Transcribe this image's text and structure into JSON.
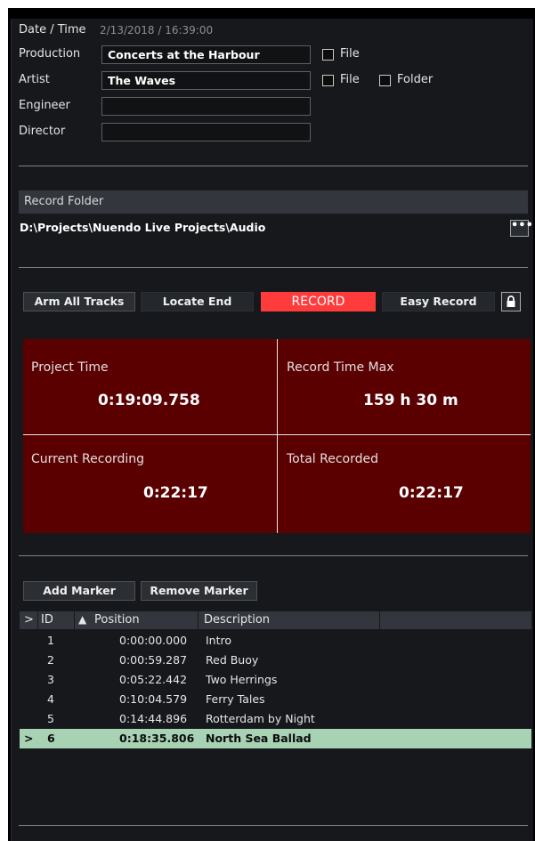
{
  "info": {
    "datetime_label": "Date / Time",
    "datetime_value": "2/13/2018  /  16:39:00",
    "production_label": "Production",
    "production_value": "Concerts at the Harbour",
    "artist_label": "Artist",
    "artist_value": "The Waves",
    "engineer_label": "Engineer",
    "engineer_value": "",
    "director_label": "Director",
    "director_value": "",
    "file_checkbox_label": "File",
    "folder_checkbox_label": "Folder"
  },
  "record_folder": {
    "header": "Record Folder",
    "path": "D:\\Projects\\Nuendo Live Projects\\Audio",
    "browse_label": "•••"
  },
  "controls": {
    "arm_all": "Arm All Tracks",
    "locate_end": "Locate End",
    "record": "RECORD",
    "easy_record": "Easy Record",
    "lock_icon": "lock-icon"
  },
  "stats": {
    "project_time_label": "Project Time",
    "project_time_value": "0:19:09.758",
    "record_time_max_label": "Record Time Max",
    "record_time_max_value": "159 h  30 m",
    "current_recording_label": "Current Recording",
    "current_recording_value": "0:22:17",
    "total_recorded_label": "Total Recorded",
    "total_recorded_value": "0:22:17"
  },
  "markers": {
    "add_label": "Add Marker",
    "remove_label": "Remove Marker",
    "columns": {
      "pointer": ">",
      "id": "ID",
      "sort_glyph": "▲",
      "position": "Position",
      "description": "Description"
    },
    "rows": [
      {
        "pointer": "",
        "id": "1",
        "position": "0:00:00.000",
        "description": "Intro"
      },
      {
        "pointer": "",
        "id": "2",
        "position": "0:00:59.287",
        "description": "Red Buoy"
      },
      {
        "pointer": "",
        "id": "3",
        "position": "0:05:22.442",
        "description": "Two Herrings"
      },
      {
        "pointer": "",
        "id": "4",
        "position": "0:10:04.579",
        "description": "Ferry Tales"
      },
      {
        "pointer": "",
        "id": "5",
        "position": "0:14:44.896",
        "description": "Rotterdam by Night"
      },
      {
        "pointer": ">",
        "id": "6",
        "position": "0:18:35.806",
        "description": "North Sea Ballad"
      }
    ],
    "selected_id": "6"
  },
  "colors": {
    "panel_bg": "#16181b",
    "record_red": "#ff3b3b",
    "stats_bg": "#5a0000",
    "selected_row": "#a8d2b4"
  }
}
